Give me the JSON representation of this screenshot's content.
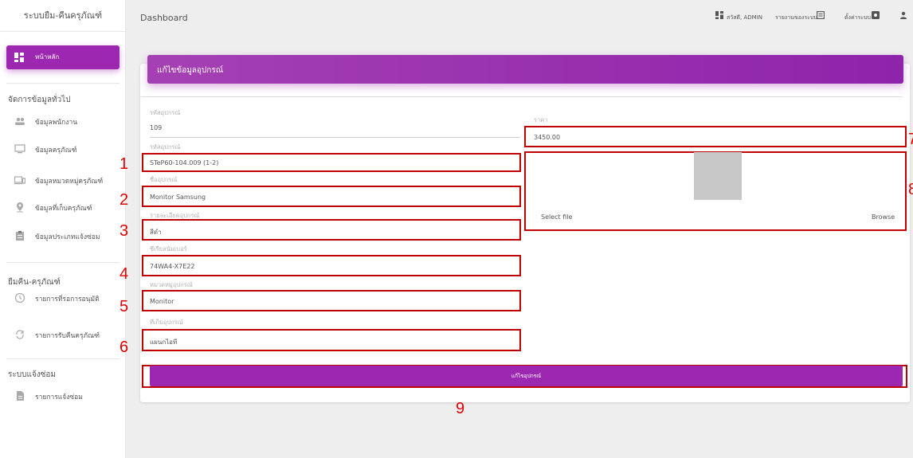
{
  "app": {
    "brand": "ระบบยืม-คืนครุภัณฑ์",
    "page_title": "Dashboard"
  },
  "topbar": {
    "user_label": "สวัสดี, ADMIN",
    "report_label": "รายงานของระบบ",
    "settings_label": "ตั้งค่าระบบ"
  },
  "sidebar": {
    "home_label": "หน้าหลัก",
    "section1_title": "จัดการข้อมูลทั่วไป",
    "section1_items": [
      {
        "label": "ข้อมูลพนักงาน",
        "icon": "people-icon"
      },
      {
        "label": "ข้อมูลครุภัณฑ์",
        "icon": "monitor-icon"
      },
      {
        "label": "ข้อมูลหมวดหมู่ครุภัณฑ์",
        "icon": "devices-icon"
      },
      {
        "label": "ข้อมูลที่เก็บครุภัณฑ์",
        "icon": "location-icon"
      },
      {
        "label": "ข้อมูลประเภทแจ้งซ่อม",
        "icon": "clipboard-icon"
      }
    ],
    "section2_title": "ยืมคืน-ครุภัณฑ์",
    "section2_items": [
      {
        "label": "รายการที่รอการอนุมัติ",
        "icon": "clock-icon"
      },
      {
        "label": "รายการรับคืนครุภัณฑ์",
        "icon": "sync-icon"
      }
    ],
    "section3_title": "ระบบแจ้งซ่อม",
    "section3_items": [
      {
        "label": "รายการแจ้งซ่อม",
        "icon": "document-icon"
      }
    ]
  },
  "form": {
    "title": "แก้ไขข้อมูลอุปกรณ์",
    "fields": {
      "id": {
        "label": "รหัสอุปกรณ์",
        "value": "109"
      },
      "code": {
        "label": "รหัสอุปกรณ์",
        "value": "STeP60-104.009 (1-2)"
      },
      "name": {
        "label": "ชื่ออุปกรณ์",
        "value": "Monitor Samsung"
      },
      "detail": {
        "label": "รายละเอียดอุปกรณ์",
        "value": "สีดำ"
      },
      "serial": {
        "label": "ซีเรียลนัมเบอร์",
        "value": "74WA4-X7E22"
      },
      "category": {
        "label": "หมวดหมู่อุปกรณ์",
        "value": "Monitor"
      },
      "location": {
        "label": "ที่เก็บอุปกรณ์",
        "value": "แผนกไอที"
      },
      "price": {
        "label": "ราคา",
        "value": "3450.00"
      }
    },
    "file": {
      "select_label": "Select file",
      "browse_label": "Browse"
    },
    "submit_label": "แก้ไขอุปกรณ์"
  },
  "annotations": [
    "1",
    "2",
    "3",
    "4",
    "5",
    "6",
    "7",
    "8",
    "9"
  ],
  "colors": {
    "accent": "#9c27b0",
    "annotation": "#c00000"
  }
}
